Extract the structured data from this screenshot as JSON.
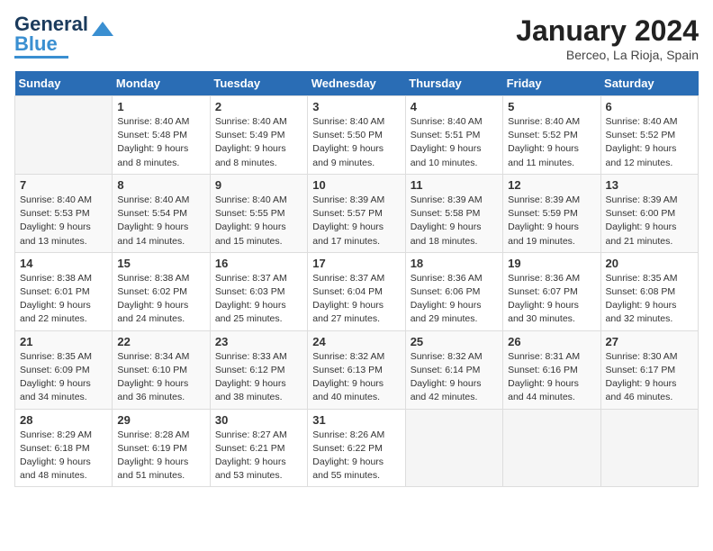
{
  "logo": {
    "line1": "General",
    "line2": "Blue"
  },
  "title": "January 2024",
  "subtitle": "Berceo, La Rioja, Spain",
  "days_of_week": [
    "Sunday",
    "Monday",
    "Tuesday",
    "Wednesday",
    "Thursday",
    "Friday",
    "Saturday"
  ],
  "weeks": [
    [
      {
        "day": "",
        "info": ""
      },
      {
        "day": "1",
        "info": "Sunrise: 8:40 AM\nSunset: 5:48 PM\nDaylight: 9 hours\nand 8 minutes."
      },
      {
        "day": "2",
        "info": "Sunrise: 8:40 AM\nSunset: 5:49 PM\nDaylight: 9 hours\nand 8 minutes."
      },
      {
        "day": "3",
        "info": "Sunrise: 8:40 AM\nSunset: 5:50 PM\nDaylight: 9 hours\nand 9 minutes."
      },
      {
        "day": "4",
        "info": "Sunrise: 8:40 AM\nSunset: 5:51 PM\nDaylight: 9 hours\nand 10 minutes."
      },
      {
        "day": "5",
        "info": "Sunrise: 8:40 AM\nSunset: 5:52 PM\nDaylight: 9 hours\nand 11 minutes."
      },
      {
        "day": "6",
        "info": "Sunrise: 8:40 AM\nSunset: 5:52 PM\nDaylight: 9 hours\nand 12 minutes."
      }
    ],
    [
      {
        "day": "7",
        "info": "Sunrise: 8:40 AM\nSunset: 5:53 PM\nDaylight: 9 hours\nand 13 minutes."
      },
      {
        "day": "8",
        "info": "Sunrise: 8:40 AM\nSunset: 5:54 PM\nDaylight: 9 hours\nand 14 minutes."
      },
      {
        "day": "9",
        "info": "Sunrise: 8:40 AM\nSunset: 5:55 PM\nDaylight: 9 hours\nand 15 minutes."
      },
      {
        "day": "10",
        "info": "Sunrise: 8:39 AM\nSunset: 5:57 PM\nDaylight: 9 hours\nand 17 minutes."
      },
      {
        "day": "11",
        "info": "Sunrise: 8:39 AM\nSunset: 5:58 PM\nDaylight: 9 hours\nand 18 minutes."
      },
      {
        "day": "12",
        "info": "Sunrise: 8:39 AM\nSunset: 5:59 PM\nDaylight: 9 hours\nand 19 minutes."
      },
      {
        "day": "13",
        "info": "Sunrise: 8:39 AM\nSunset: 6:00 PM\nDaylight: 9 hours\nand 21 minutes."
      }
    ],
    [
      {
        "day": "14",
        "info": "Sunrise: 8:38 AM\nSunset: 6:01 PM\nDaylight: 9 hours\nand 22 minutes."
      },
      {
        "day": "15",
        "info": "Sunrise: 8:38 AM\nSunset: 6:02 PM\nDaylight: 9 hours\nand 24 minutes."
      },
      {
        "day": "16",
        "info": "Sunrise: 8:37 AM\nSunset: 6:03 PM\nDaylight: 9 hours\nand 25 minutes."
      },
      {
        "day": "17",
        "info": "Sunrise: 8:37 AM\nSunset: 6:04 PM\nDaylight: 9 hours\nand 27 minutes."
      },
      {
        "day": "18",
        "info": "Sunrise: 8:36 AM\nSunset: 6:06 PM\nDaylight: 9 hours\nand 29 minutes."
      },
      {
        "day": "19",
        "info": "Sunrise: 8:36 AM\nSunset: 6:07 PM\nDaylight: 9 hours\nand 30 minutes."
      },
      {
        "day": "20",
        "info": "Sunrise: 8:35 AM\nSunset: 6:08 PM\nDaylight: 9 hours\nand 32 minutes."
      }
    ],
    [
      {
        "day": "21",
        "info": "Sunrise: 8:35 AM\nSunset: 6:09 PM\nDaylight: 9 hours\nand 34 minutes."
      },
      {
        "day": "22",
        "info": "Sunrise: 8:34 AM\nSunset: 6:10 PM\nDaylight: 9 hours\nand 36 minutes."
      },
      {
        "day": "23",
        "info": "Sunrise: 8:33 AM\nSunset: 6:12 PM\nDaylight: 9 hours\nand 38 minutes."
      },
      {
        "day": "24",
        "info": "Sunrise: 8:32 AM\nSunset: 6:13 PM\nDaylight: 9 hours\nand 40 minutes."
      },
      {
        "day": "25",
        "info": "Sunrise: 8:32 AM\nSunset: 6:14 PM\nDaylight: 9 hours\nand 42 minutes."
      },
      {
        "day": "26",
        "info": "Sunrise: 8:31 AM\nSunset: 6:16 PM\nDaylight: 9 hours\nand 44 minutes."
      },
      {
        "day": "27",
        "info": "Sunrise: 8:30 AM\nSunset: 6:17 PM\nDaylight: 9 hours\nand 46 minutes."
      }
    ],
    [
      {
        "day": "28",
        "info": "Sunrise: 8:29 AM\nSunset: 6:18 PM\nDaylight: 9 hours\nand 48 minutes."
      },
      {
        "day": "29",
        "info": "Sunrise: 8:28 AM\nSunset: 6:19 PM\nDaylight: 9 hours\nand 51 minutes."
      },
      {
        "day": "30",
        "info": "Sunrise: 8:27 AM\nSunset: 6:21 PM\nDaylight: 9 hours\nand 53 minutes."
      },
      {
        "day": "31",
        "info": "Sunrise: 8:26 AM\nSunset: 6:22 PM\nDaylight: 9 hours\nand 55 minutes."
      },
      {
        "day": "",
        "info": ""
      },
      {
        "day": "",
        "info": ""
      },
      {
        "day": "",
        "info": ""
      }
    ]
  ]
}
